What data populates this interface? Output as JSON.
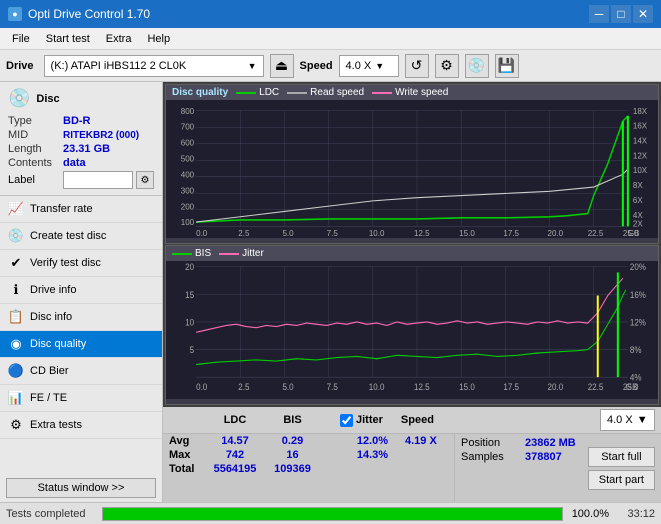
{
  "titlebar": {
    "title": "Opti Drive Control 1.70",
    "icon": "●",
    "controls": [
      "—",
      "□",
      "✕"
    ]
  },
  "menubar": {
    "items": [
      "File",
      "Start test",
      "Extra",
      "Help"
    ]
  },
  "toolbar": {
    "drive_label": "Drive",
    "drive_value": "(K:)  ATAPI iHBS112  2 CL0K",
    "speed_label": "Speed",
    "speed_value": "4.0 X"
  },
  "disc_panel": {
    "disc_label": "Disc",
    "type_label": "Type",
    "type_value": "BD-R",
    "mid_label": "MID",
    "mid_value": "RITEKBR2 (000)",
    "length_label": "Length",
    "length_value": "23.31 GB",
    "contents_label": "Contents",
    "contents_value": "data",
    "label_label": "Label",
    "label_value": ""
  },
  "nav_items": [
    {
      "id": "transfer-rate",
      "label": "Transfer rate",
      "icon": "📈"
    },
    {
      "id": "create-test-disc",
      "label": "Create test disc",
      "icon": "💿"
    },
    {
      "id": "verify-test-disc",
      "label": "Verify test disc",
      "icon": "✔"
    },
    {
      "id": "drive-info",
      "label": "Drive info",
      "icon": "ℹ"
    },
    {
      "id": "disc-info",
      "label": "Disc info",
      "icon": "📋"
    },
    {
      "id": "disc-quality",
      "label": "Disc quality",
      "icon": "◉",
      "active": true
    },
    {
      "id": "cd-bier",
      "label": "CD Bier",
      "icon": "🔵"
    },
    {
      "id": "fe-te",
      "label": "FE / TE",
      "icon": "📊"
    },
    {
      "id": "extra-tests",
      "label": "Extra tests",
      "icon": "⚙"
    }
  ],
  "status_btn": "Status window >>",
  "chart1": {
    "title": "Disc quality",
    "legend": [
      {
        "label": "LDC",
        "color": "#00aa00"
      },
      {
        "label": "Read speed",
        "color": "#aaaaaa"
      },
      {
        "label": "Write speed",
        "color": "#ff69b4"
      }
    ],
    "y_left_max": 800,
    "y_right_max": 18,
    "x_max": 25,
    "x_labels": [
      "0.0",
      "2.5",
      "5.0",
      "7.5",
      "10.0",
      "12.5",
      "15.0",
      "17.5",
      "20.0",
      "22.5",
      "25.0"
    ],
    "y_right_labels": [
      "18X",
      "16X",
      "14X",
      "12X",
      "10X",
      "8X",
      "6X",
      "4X",
      "2X"
    ]
  },
  "chart2": {
    "legend": [
      {
        "label": "BIS",
        "color": "#00aa00"
      },
      {
        "label": "Jitter",
        "color": "#ff69b4"
      }
    ],
    "y_left_max": 20,
    "y_right_max": 20,
    "x_max": 25,
    "x_labels": [
      "0.0",
      "2.5",
      "5.0",
      "7.5",
      "10.0",
      "12.5",
      "15.0",
      "17.5",
      "20.0",
      "22.5",
      "25.0"
    ],
    "y_right_labels": [
      "20%",
      "16%",
      "12%",
      "8%",
      "4%"
    ],
    "y_left_labels": [
      "20",
      "15",
      "10",
      "5"
    ]
  },
  "stats": {
    "columns": [
      "LDC",
      "BIS",
      "",
      "Jitter",
      "Speed"
    ],
    "avg_label": "Avg",
    "avg_ldc": "14.57",
    "avg_bis": "0.29",
    "avg_jitter": "12.0%",
    "avg_speed": "4.19 X",
    "speed_dropdown": "4.0 X",
    "max_label": "Max",
    "max_ldc": "742",
    "max_bis": "16",
    "max_jitter": "14.3%",
    "position_label": "Position",
    "position_value": "23862 MB",
    "total_label": "Total",
    "total_ldc": "5564195",
    "total_bis": "109369",
    "samples_label": "Samples",
    "samples_value": "378807",
    "start_full_label": "Start full",
    "start_part_label": "Start part"
  },
  "progress": {
    "label": "Tests completed",
    "value": 100,
    "pct": "100.0%",
    "time": "33:12"
  }
}
